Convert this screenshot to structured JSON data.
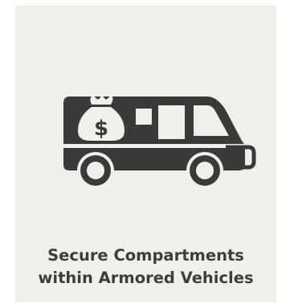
{
  "card": {
    "icon": "armored-van-money-bag-icon",
    "caption_line1": "Secure Compartments",
    "caption_line2": "within Armored Vehicles",
    "colors": {
      "background": "#f0efea",
      "icon": "#3a3a3a",
      "text": "#3d3d3d"
    }
  }
}
